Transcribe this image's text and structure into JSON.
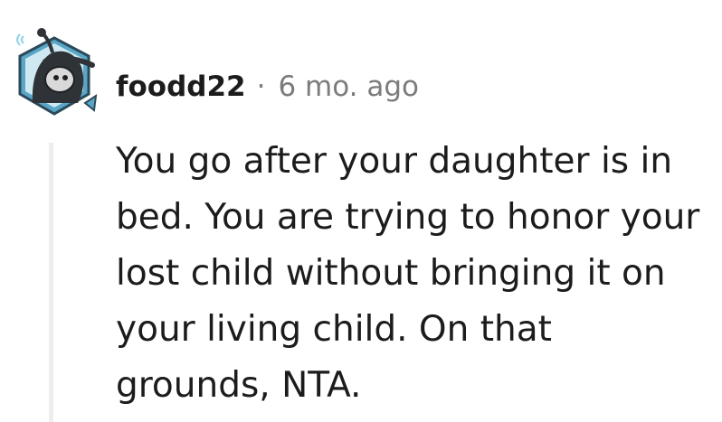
{
  "comment": {
    "username": "foodd22",
    "separator": "·",
    "timestamp": "6 mo. ago",
    "body": "You go after your daughter is in bed. You are trying to honor your lost child without bringing it on your living child. On that grounds, NTA."
  },
  "avatar": {
    "icon": "snoo-avatar-icon",
    "colors": {
      "hood": "#2f3236",
      "frame": "#5aa6c6",
      "accent": "#8fd3e8"
    }
  },
  "colors": {
    "text": "#1c1c1c",
    "meta": "#7c7c7c",
    "thread_line": "#ededed"
  }
}
